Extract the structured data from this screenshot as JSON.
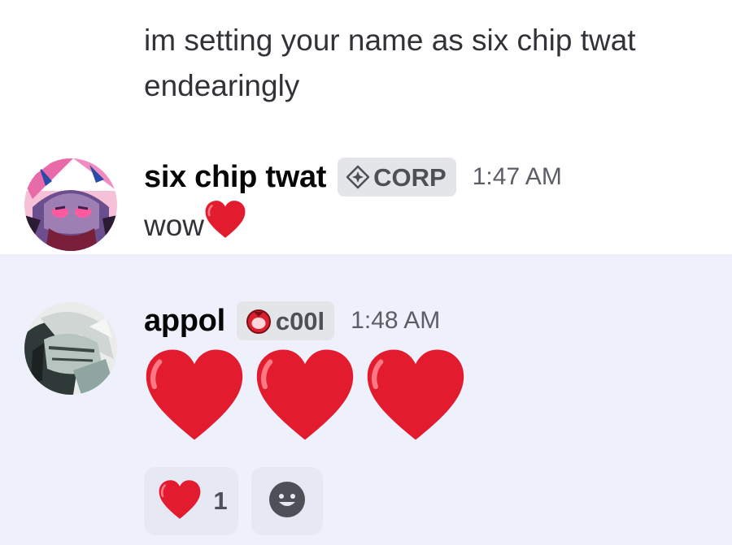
{
  "messages": [
    {
      "continuation": true,
      "text": "im setting your name as six chip twat endearingly"
    },
    {
      "username": "six chip twat",
      "tag": {
        "text": "CORP",
        "icon": "diamond-cross-icon"
      },
      "timestamp": "1:47 AM",
      "text": "wow",
      "emoji": "red-heart"
    },
    {
      "username": "appol",
      "tag": {
        "text": "c00l",
        "icon": "red-mask-icon"
      },
      "timestamp": "1:48 AM",
      "emojis": [
        "red-heart",
        "red-heart",
        "red-heart"
      ],
      "reactions": [
        {
          "emoji": "red-heart",
          "count": "1"
        },
        {
          "emoji": "add-reaction-smiley"
        }
      ]
    }
  ],
  "colors": {
    "highlight_background": "#eef0fb",
    "tag_background": "#e3e5e8",
    "heart_red": "#e21b2e",
    "username": "#060607",
    "timestamp": "#5c5e66"
  }
}
